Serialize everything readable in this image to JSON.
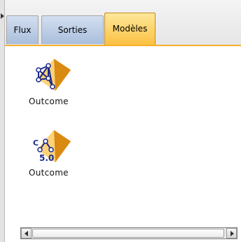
{
  "tabs": [
    {
      "label": "Flux",
      "active": false
    },
    {
      "label": "Sorties",
      "active": false
    },
    {
      "label": "Modèles",
      "active": true
    }
  ],
  "models": [
    {
      "label": "Outcome",
      "icon": "neural-net-model-icon"
    },
    {
      "label": "Outcome",
      "icon": "c50-model-icon",
      "icon_text": "5.0",
      "icon_prefix": "C"
    }
  ],
  "colors": {
    "accent": "#f7b12a",
    "tab_active": "#fbc143",
    "tab_inactive": "#b9cbe5",
    "nugget": "#f0a020"
  }
}
